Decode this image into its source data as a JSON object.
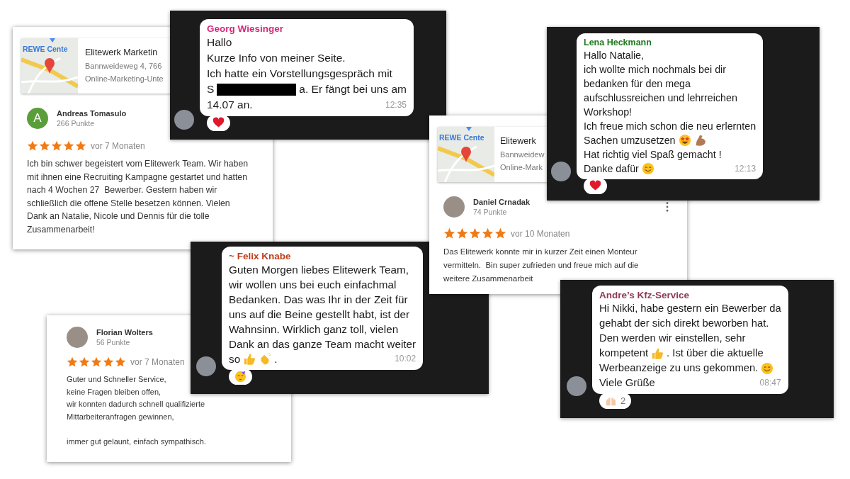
{
  "items": [
    {
      "kind": "review",
      "map": {
        "label": "REWE Cente",
        "title": "Elitewerk Marketin",
        "address": "Bannweideweg 4, 766",
        "category": "Online-Marketing-Unte"
      },
      "reviewer": {
        "avatar": {
          "kind": "letter",
          "initial": "A"
        },
        "name": "Andreas Tomasulo",
        "points": "266 Punkte"
      },
      "menu": false,
      "stars": 5,
      "time": "vor 7 Monaten",
      "text": "Ich bin schwer begeistert vom Elitewerk Team. Wir haben\nmit ihnen eine Recruiting Kampagne gestartet und hatten\nnach 4 Wochen 27  Bewerber. Gestern haben wir\nschließlich die offene Stelle besetzen können. Vielen\nDank an Natalie, Nicole und Dennis für die tolle\nZusammenarbeit!"
    },
    {
      "kind": "chat",
      "sender": "Georg Wiesinger",
      "color": "#d6287a",
      "lines": [
        [
          {
            "kind": "text",
            "text": "Hallo"
          }
        ],
        [
          {
            "kind": "text",
            "text": "Kurze Info von meiner Seite."
          }
        ],
        [
          {
            "kind": "text",
            "text": "Ich hatte ein Vorstellungsgespräch mit"
          }
        ],
        [
          {
            "kind": "text",
            "text": "S"
          },
          {
            "kind": "redaction"
          },
          {
            "kind": "text",
            "text": "a. Er fängt bei uns am"
          }
        ],
        [
          {
            "kind": "text",
            "text": "14.07 an."
          }
        ]
      ],
      "time": "12:35",
      "reaction": {
        "kind": "heart"
      }
    },
    {
      "kind": "review",
      "map": {
        "label": "REWE Cente",
        "title": "Elitewerk",
        "address": "Bannweidew",
        "category": "Online-Mark"
      },
      "reviewer": {
        "avatar": {
          "kind": "photo"
        },
        "name": "Daniel Crnadak",
        "points": "74 Punkte"
      },
      "menu": true,
      "stars": 5,
      "time": "vor 10 Monaten",
      "text": "Das Elitewerk konnte mir in kurzer Zeit einen Monteur\nvermitteln.  Bin super zufrieden und freue mich auf die\nweitere Zusammenarbeit"
    },
    {
      "kind": "chat",
      "sender": "Lena Heckmann",
      "color": "#1f7a1f",
      "lines": [
        [
          {
            "kind": "text",
            "text": "Hallo Natalie,"
          }
        ],
        [
          {
            "kind": "text",
            "text": "ich wollte mich nochmals bei dir"
          }
        ],
        [
          {
            "kind": "text",
            "text": "bedanken für den mega"
          }
        ],
        [
          {
            "kind": "text",
            "text": "aufschlussreichen und lehrreichen"
          }
        ],
        [
          {
            "kind": "text",
            "text": "Workshop!"
          }
        ],
        [
          {
            "kind": "text",
            "text": "Ich freue mich schon die neu erlernten"
          }
        ],
        [
          {
            "kind": "text",
            "text": "Sachen umzusetzen"
          },
          {
            "kind": "star-eyes"
          },
          {
            "kind": "flexed-arm"
          }
        ],
        [
          {
            "kind": "text",
            "text": "Hat richtig viel Spaß gemacht !"
          }
        ],
        [
          {
            "kind": "text",
            "text": "Danke dafür"
          },
          {
            "kind": "smile"
          }
        ]
      ],
      "time": "12:13",
      "reaction": {
        "kind": "heart"
      }
    },
    {
      "kind": "chat",
      "sender": "~ Felix Knabe",
      "color": "#c0401a",
      "lines": [
        [
          {
            "kind": "text",
            "text": "Guten Morgen liebes Elitewerk Team,"
          }
        ],
        [
          {
            "kind": "text",
            "text": "wir wollen uns bei euch einfachmal"
          }
        ],
        [
          {
            "kind": "text",
            "text": "Bedanken. Das was Ihr in der Zeit für"
          }
        ],
        [
          {
            "kind": "text",
            "text": "uns auf die Beine gestellt habt, ist der"
          }
        ],
        [
          {
            "kind": "text",
            "text": "Wahnsinn. Wirklich ganz toll, vielen"
          }
        ],
        [
          {
            "kind": "text",
            "text": "Dank an das ganze Team macht weiter"
          }
        ],
        [
          {
            "kind": "text",
            "text": "so"
          },
          {
            "kind": "thumbs-up"
          },
          {
            "kind": "clap"
          },
          {
            "kind": "text",
            "text": "."
          }
        ]
      ],
      "time": "10:02",
      "reaction": {
        "kind": "party"
      }
    },
    {
      "kind": "review",
      "reviewer": {
        "avatar": {
          "kind": "photo"
        },
        "name": "Florian Wolters",
        "points": "56 Punkte"
      },
      "menu": false,
      "stars": 5,
      "time": "vor 7 Monaten",
      "text": "Guter und Schneller Service,\nkeine Fragen bleiben offen,\nwir konnten dadurch schnell qualifizierte\nMittarbeiteranfragen gewinnen,\n\nimmer gut gelaunt, einfach sympathisch."
    },
    {
      "kind": "chat",
      "sender": "Andre’s Kfz-Service",
      "color": "#8c3a55",
      "lines": [
        [
          {
            "kind": "text",
            "text": "Hi Nikki, habe gestern ein Bewerber da"
          }
        ],
        [
          {
            "kind": "text",
            "text": "gehabt der sich direkt beworben hat."
          }
        ],
        [
          {
            "kind": "text",
            "text": "Den werden wir einstellen, sehr"
          }
        ],
        [
          {
            "kind": "text",
            "text": "kompetent"
          },
          {
            "kind": "thumbs-up"
          },
          {
            "kind": "text",
            "text": ". Ist über die aktuelle"
          }
        ],
        [
          {
            "kind": "text",
            "text": "Werbeanzeige zu uns gekommen."
          },
          {
            "kind": "smile"
          }
        ],
        [
          {
            "kind": "text",
            "text": "Viele Grüße"
          }
        ]
      ],
      "time": "08:47",
      "reaction": {
        "kind": "raised-hands",
        "count": "2"
      }
    }
  ]
}
